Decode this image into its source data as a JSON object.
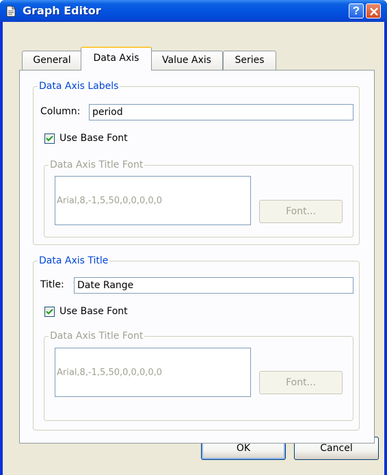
{
  "window": {
    "title": "Graph Editor",
    "icon": "document-icon",
    "help_button_label": "?",
    "close_icon": "close-icon"
  },
  "tabs": [
    {
      "label": "General",
      "active": false
    },
    {
      "label": "Data Axis",
      "active": true
    },
    {
      "label": "Value Axis",
      "active": false
    },
    {
      "label": "Series",
      "active": false
    }
  ],
  "data_axis_labels": {
    "group_title": "Data Axis Labels",
    "column_label": "Column:",
    "column_value": "period",
    "use_base_font_label": "Use Base Font",
    "use_base_font_checked": true,
    "font_group_title": "Data Axis Title Font",
    "font_value": "Arial,8,-1,5,50,0,0,0,0,0",
    "font_button_label": "Font..."
  },
  "data_axis_title": {
    "group_title": "Data Axis Title",
    "title_label": "Title:",
    "title_value": "Date Range",
    "use_base_font_label": "Use Base Font",
    "use_base_font_checked": true,
    "font_group_title": "Data Axis Title Font",
    "font_value": "Arial,8,-1,5,50,0,0,0,0,0",
    "font_button_label": "Font..."
  },
  "buttons": {
    "ok_label": "OK",
    "cancel_label": "Cancel"
  },
  "colors": {
    "titlebar": "#0454e0",
    "dialog_bg": "#ece9d8",
    "group_title": "#0046d5",
    "disabled_text": "#a1a192",
    "active_tab_highlight": "#ffc83c"
  }
}
